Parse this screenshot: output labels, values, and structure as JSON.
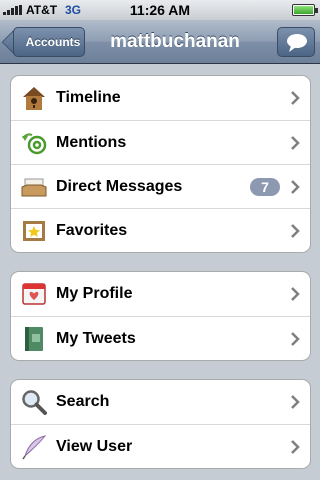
{
  "status_bar": {
    "carrier": "AT&T",
    "network": "3G",
    "time": "11:26 AM"
  },
  "nav": {
    "back_label": "Accounts",
    "title": "mattbuchanan"
  },
  "groups": [
    {
      "items": [
        {
          "label": "Timeline",
          "icon": "birdhouse-icon"
        },
        {
          "label": "Mentions",
          "icon": "at-sign-icon"
        },
        {
          "label": "Direct Messages",
          "icon": "inbox-tray-icon",
          "badge": "7"
        },
        {
          "label": "Favorites",
          "icon": "star-frame-icon"
        }
      ]
    },
    {
      "items": [
        {
          "label": "My Profile",
          "icon": "profile-card-icon"
        },
        {
          "label": "My Tweets",
          "icon": "notebook-icon"
        }
      ]
    },
    {
      "items": [
        {
          "label": "Search",
          "icon": "magnifier-icon"
        },
        {
          "label": "View User",
          "icon": "quill-icon"
        }
      ]
    }
  ],
  "colors": {
    "navbar": "#7e8fa7",
    "background": "#c5ccd4",
    "badge": "#8c99b0",
    "network": "#1f4ea3"
  }
}
